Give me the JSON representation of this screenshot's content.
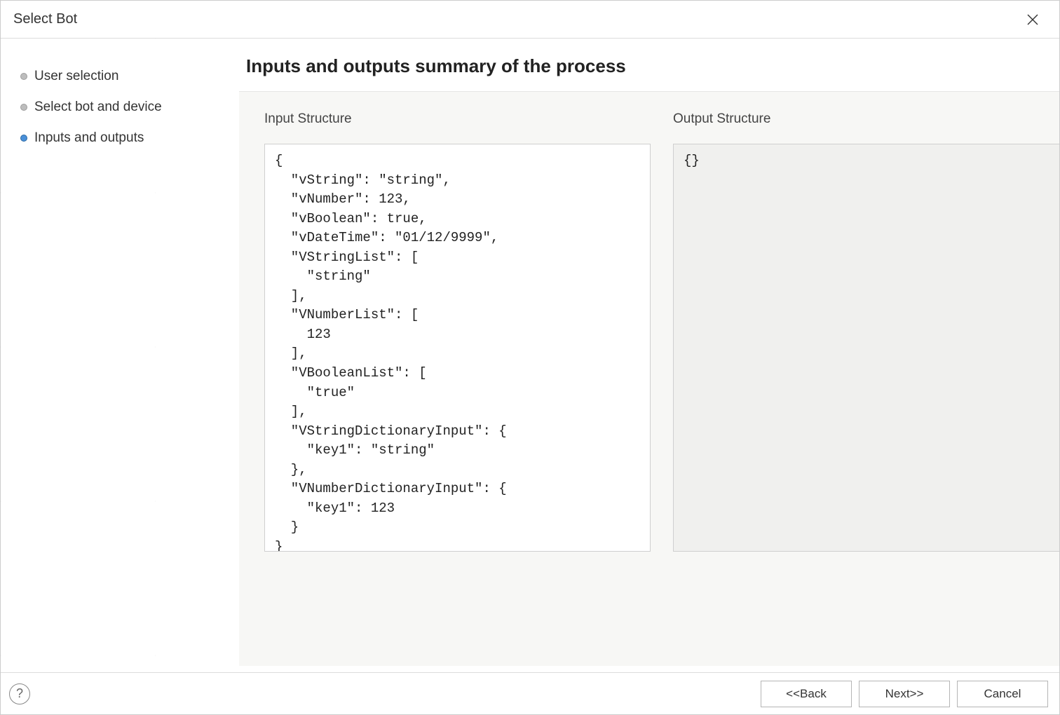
{
  "window": {
    "title": "Select Bot"
  },
  "sidebar": {
    "items": [
      {
        "label": "User selection",
        "active": false
      },
      {
        "label": "Select bot and device",
        "active": false
      },
      {
        "label": "Inputs and outputs",
        "active": true
      }
    ]
  },
  "main": {
    "heading": "Inputs and outputs summary of the process",
    "input_label": "Input Structure",
    "output_label": "Output Structure",
    "input_structure": "{\n  \"vString\": \"string\",\n  \"vNumber\": 123,\n  \"vBoolean\": true,\n  \"vDateTime\": \"01/12/9999\",\n  \"VStringList\": [\n    \"string\"\n  ],\n  \"VNumberList\": [\n    123\n  ],\n  \"VBooleanList\": [\n    \"true\"\n  ],\n  \"VStringDictionaryInput\": {\n    \"key1\": \"string\"\n  },\n  \"VNumberDictionaryInput\": {\n    \"key1\": 123\n  }\n}",
    "output_structure": "{}"
  },
  "footer": {
    "back_label": "<<Back",
    "next_label": "Next>>",
    "cancel_label": "Cancel"
  }
}
